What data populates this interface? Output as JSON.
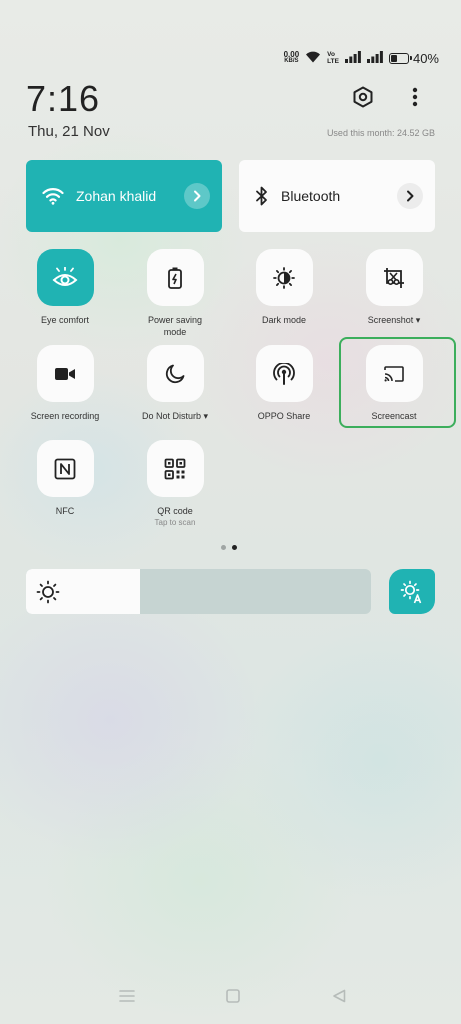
{
  "status_bar": {
    "net_speed": "0.00",
    "net_unit": "KB/S",
    "volte_top": "Vo",
    "volte_bottom": "LTE",
    "battery_percent": "40%",
    "battery_level": 0.4
  },
  "header": {
    "time": "7:16",
    "date": "Thu, 21 Nov",
    "usage": "Used this month: 24.52 GB"
  },
  "wide_tiles": {
    "wifi": {
      "label": "Zohan khalid",
      "active": true
    },
    "bluetooth": {
      "label": "Bluetooth",
      "active": false
    }
  },
  "toggles": [
    {
      "label": "Eye comfort",
      "icon": "eye-icon",
      "active": true
    },
    {
      "label": "Power saving",
      "label2": "mode",
      "icon": "battery-icon",
      "active": false
    },
    {
      "label": "Dark mode",
      "icon": "dark-mode-icon",
      "active": false
    },
    {
      "label": "Screenshot ▾",
      "icon": "screenshot-icon",
      "active": false
    },
    {
      "label": "Screen recording",
      "icon": "video-camera-icon",
      "active": false
    },
    {
      "label": "Do Not Disturb ▾",
      "icon": "moon-icon",
      "active": false
    },
    {
      "label": "OPPO Share",
      "icon": "share-signal-icon",
      "active": false
    },
    {
      "label": "Screencast",
      "icon": "cast-icon",
      "active": false
    },
    {
      "label": "NFC",
      "icon": "nfc-icon",
      "active": false
    },
    {
      "label": "QR code",
      "sub": "Tap to scan",
      "icon": "qr-code-icon",
      "active": false
    }
  ],
  "pager": {
    "pages": 2,
    "current": 2
  },
  "brightness": {
    "level": 0.33
  },
  "colors": {
    "accent": "#20b3b3",
    "tile": "#fbfbfb",
    "highlight": "#3cae5c"
  }
}
